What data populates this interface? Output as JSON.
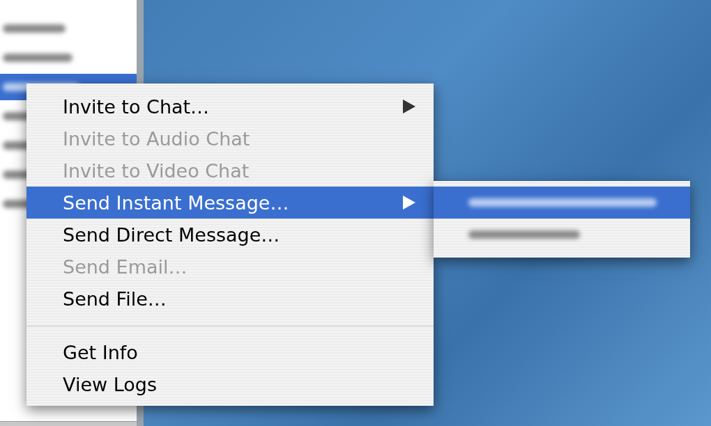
{
  "buddy_list": {
    "rows": [
      {
        "selected": false
      },
      {
        "selected": false
      },
      {
        "selected": true
      },
      {
        "selected": false
      },
      {
        "selected": false
      },
      {
        "selected": false
      },
      {
        "selected": false
      }
    ]
  },
  "context_menu": {
    "items": [
      {
        "kind": "item",
        "label": "Invite to Chat…",
        "disabled": false,
        "selected": false,
        "has_submenu": true
      },
      {
        "kind": "item",
        "label": "Invite to Audio Chat",
        "disabled": true,
        "selected": false,
        "has_submenu": false
      },
      {
        "kind": "item",
        "label": "Invite to Video Chat",
        "disabled": true,
        "selected": false,
        "has_submenu": false
      },
      {
        "kind": "item",
        "label": "Send Instant Message…",
        "disabled": false,
        "selected": true,
        "has_submenu": true
      },
      {
        "kind": "item",
        "label": "Send Direct Message…",
        "disabled": false,
        "selected": false,
        "has_submenu": false
      },
      {
        "kind": "item",
        "label": "Send Email…",
        "disabled": true,
        "selected": false,
        "has_submenu": false
      },
      {
        "kind": "item",
        "label": "Send File…",
        "disabled": false,
        "selected": false,
        "has_submenu": false
      },
      {
        "kind": "separator"
      },
      {
        "kind": "item",
        "label": "Get Info",
        "disabled": false,
        "selected": false,
        "has_submenu": false
      },
      {
        "kind": "item",
        "label": "View Logs",
        "disabled": false,
        "selected": false,
        "has_submenu": false
      }
    ]
  },
  "submenu": {
    "items": [
      {
        "selected": true
      },
      {
        "selected": false
      }
    ]
  }
}
